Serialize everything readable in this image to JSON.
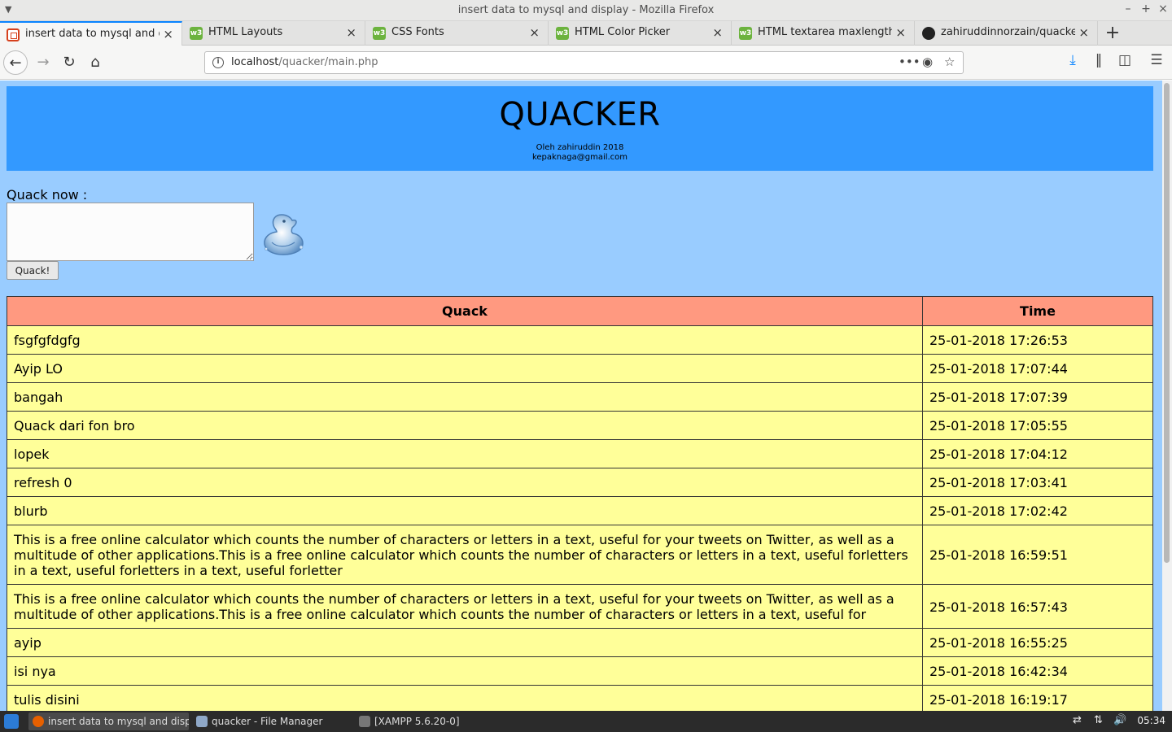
{
  "window": {
    "title": "insert data to mysql and display - Mozilla Firefox"
  },
  "tabs": [
    {
      "label": "insert data to mysql and displ",
      "favicon": "error-page-icon"
    },
    {
      "label": "HTML Layouts",
      "favicon": "w3schools-icon"
    },
    {
      "label": "CSS Fonts",
      "favicon": "w3schools-icon"
    },
    {
      "label": "HTML Color Picker",
      "favicon": "w3schools-icon"
    },
    {
      "label": "HTML textarea maxlength Att",
      "favicon": "w3schools-icon"
    },
    {
      "label": "zahiruddinnorzain/quacker",
      "favicon": "github-icon"
    }
  ],
  "urlbar": {
    "host": "localhost",
    "path": "/quacker/main.php"
  },
  "page": {
    "header": {
      "title": "QUACKER",
      "credit_line1": "Oleh zahiruddin 2018",
      "credit_line2": "kepaknaga@gmail.com"
    },
    "form": {
      "label": "Quack now :",
      "textarea_value": "",
      "button_label": "Quack!"
    },
    "table": {
      "headers": [
        "Quack",
        "Time"
      ],
      "rows": [
        {
          "quack": "fsgfgfdgfg",
          "time": "25-01-2018 17:26:53"
        },
        {
          "quack": "Ayip LO",
          "time": "25-01-2018 17:07:44"
        },
        {
          "quack": "bangah",
          "time": "25-01-2018 17:07:39"
        },
        {
          "quack": "Quack dari fon bro",
          "time": "25-01-2018 17:05:55"
        },
        {
          "quack": "lopek",
          "time": "25-01-2018 17:04:12"
        },
        {
          "quack": "refresh 0",
          "time": "25-01-2018 17:03:41"
        },
        {
          "quack": "blurb",
          "time": "25-01-2018 17:02:42"
        },
        {
          "quack": "This is a free online calculator which counts the number of characters or letters in a text, useful for your tweets on Twitter, as well as a multitude of other applications.This is a free online calculator which counts the number of characters or letters in a text, useful forletters in a text, useful forletters in a text, useful forletter",
          "time": "25-01-2018 16:59:51"
        },
        {
          "quack": "This is a free online calculator which counts the number of characters or letters in a text, useful for your tweets on Twitter, as well as a multitude of other applications.This is a free online calculator which counts the number of characters or letters in a text, useful for",
          "time": "25-01-2018 16:57:43"
        },
        {
          "quack": "ayip",
          "time": "25-01-2018 16:55:25"
        },
        {
          "quack": "isi nya",
          "time": "25-01-2018 16:42:34"
        },
        {
          "quack": "tulis disini",
          "time": "25-01-2018 16:19:17"
        }
      ]
    }
  },
  "taskbar": {
    "tasks": [
      {
        "label": "insert data to mysql and disp...",
        "icon": "firefox-icon"
      },
      {
        "label": "quacker - File Manager",
        "icon": "folder-icon"
      },
      {
        "label": "[XAMPP 5.6.20-0]",
        "icon": "window-icon"
      }
    ],
    "clock": "05:34"
  },
  "colors": {
    "page_bg": "#99ccff",
    "header_bg": "#3399ff",
    "th_bg": "#ff9980",
    "td_bg": "#ffff99"
  }
}
